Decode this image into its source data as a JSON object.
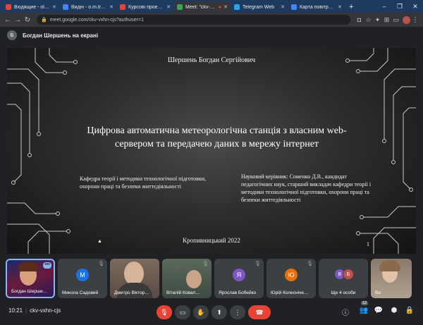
{
  "browser": {
    "tabs": [
      {
        "label": "Вхідящие - olenak",
        "color": "#ea4335"
      },
      {
        "label": "Видні - o.m.tryfonova",
        "color": "#4285f4"
      },
      {
        "label": "Курсові проекти К",
        "color": "#ea4335"
      },
      {
        "label": "Meet: \"ckv-vxh",
        "color": "#34a853",
        "active": true
      },
      {
        "label": "Telegram Web",
        "color": "#2aa3df"
      },
      {
        "label": "Карта повітряних",
        "color": "#4285f4"
      }
    ],
    "url": "meet.google.com/ckv-vxhn-cjs?authuser=1"
  },
  "presenter": {
    "initial": "Б",
    "text": "Богдан Шершень на екрані"
  },
  "slide": {
    "author": "Шершень Богдан Сергійович",
    "title": "Цифрова автоматична метеорологічна станція з власним web-сервером та передачею даних в мережу інтернет",
    "department": "Кафедра теорії і методики технологічної підготовки, охорони праці та безпеки життєдіяльності",
    "supervisor": "Науковий керівник: Соменко Д.В., кандидат педагогічних наук, старший викладач кафедри теорії і методики технологічної підготовки, охорони праці та безпеки життєдіяльності",
    "city_year": "Кропивницький 2022",
    "page": "1"
  },
  "participants": [
    {
      "name": "Богдан Шерше…",
      "type": "self",
      "more": "•••"
    },
    {
      "name": "Микола Садовий",
      "initial": "М",
      "color": "#1a73e8"
    },
    {
      "name": "Дмитро Віктор…",
      "type": "cam"
    },
    {
      "name": "Віталій Ковал…",
      "type": "cam"
    },
    {
      "name": "Ярослав Бобейко",
      "initial": "Я",
      "color": "#7e57c2"
    },
    {
      "name": "Юрій Колесніче…",
      "initial": "Ю",
      "color": "#e8710a"
    },
    {
      "name": "Ще 4 особи",
      "type": "more",
      "initials": [
        "В",
        "Б"
      ],
      "colors": [
        "#7e57c2",
        "#c0504d"
      ]
    },
    {
      "name": "Ви",
      "type": "cam"
    }
  ],
  "controls": {
    "time": "10:21",
    "meeting_code": "ckv-vxhn-cjs",
    "people_count": "12"
  }
}
